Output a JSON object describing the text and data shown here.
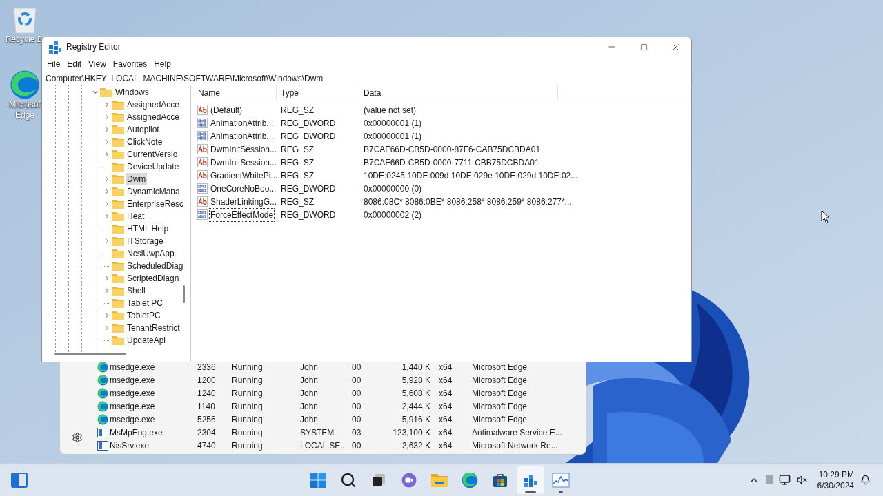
{
  "desktop_icons": [
    {
      "kind": "recycle",
      "lines": [
        "Recycle Bi"
      ]
    },
    {
      "kind": "edge",
      "lines": [
        "Microsof",
        "Edge"
      ]
    }
  ],
  "task_manager": {
    "rows": [
      {
        "kind": "edge",
        "name": "msedge.exe",
        "pid": "2336",
        "status": "Running",
        "user": "John",
        "cpu": "00",
        "memory": "1,440 K",
        "arch": "x64",
        "description": "Microsoft Edge"
      },
      {
        "kind": "edge",
        "name": "msedge.exe",
        "pid": "1200",
        "status": "Running",
        "user": "John",
        "cpu": "00",
        "memory": "5,928 K",
        "arch": "x64",
        "description": "Microsoft Edge"
      },
      {
        "kind": "edge",
        "name": "msedge.exe",
        "pid": "1240",
        "status": "Running",
        "user": "John",
        "cpu": "00",
        "memory": "5,608 K",
        "arch": "x64",
        "description": "Microsoft Edge"
      },
      {
        "kind": "edge",
        "name": "msedge.exe",
        "pid": "1140",
        "status": "Running",
        "user": "John",
        "cpu": "00",
        "memory": "2,444 K",
        "arch": "x64",
        "description": "Microsoft Edge"
      },
      {
        "kind": "edge",
        "name": "msedge.exe",
        "pid": "5256",
        "status": "Running",
        "user": "John",
        "cpu": "00",
        "memory": "5,916 K",
        "arch": "x64",
        "description": "Microsoft Edge"
      },
      {
        "kind": "app",
        "name": "MsMpEng.exe",
        "pid": "2304",
        "status": "Running",
        "user": "SYSTEM",
        "cpu": "03",
        "memory": "123,100 K",
        "arch": "x64",
        "description": "Antimalware Service E..."
      },
      {
        "kind": "app",
        "name": "NisSrv.exe",
        "pid": "4740",
        "status": "Running",
        "user": "LOCAL SE...",
        "cpu": "00",
        "memory": "2,632 K",
        "arch": "x64",
        "description": "Microsoft Network Re..."
      }
    ]
  },
  "registry": {
    "title": "Registry Editor",
    "menu": [
      "File",
      "Edit",
      "View",
      "Favorites",
      "Help"
    ],
    "address": "Computer\\HKEY_LOCAL_MACHINE\\SOFTWARE\\Microsoft\\Windows\\Dwm",
    "tree": {
      "label": "Windows",
      "expanded": true,
      "selected": false,
      "children": [
        {
          "label": "AssignedAcce",
          "expandable": true,
          "selected": false
        },
        {
          "label": "AssignedAcce",
          "expandable": true,
          "selected": false
        },
        {
          "label": "Autopilot",
          "expandable": true,
          "selected": false
        },
        {
          "label": "ClickNote",
          "expandable": true,
          "selected": false
        },
        {
          "label": "CurrentVersio",
          "expandable": true,
          "selected": false
        },
        {
          "label": "DeviceUpdate",
          "expandable": false,
          "selected": false
        },
        {
          "label": "Dwm",
          "expandable": true,
          "selected": true
        },
        {
          "label": "DynamicMana",
          "expandable": true,
          "selected": false
        },
        {
          "label": "EnterpriseResc",
          "expandable": true,
          "selected": false
        },
        {
          "label": "Heat",
          "expandable": true,
          "selected": false
        },
        {
          "label": "HTML Help",
          "expandable": false,
          "selected": false
        },
        {
          "label": "ITStorage",
          "expandable": true,
          "selected": false
        },
        {
          "label": "NcsiUwpApp",
          "expandable": false,
          "selected": false
        },
        {
          "label": "ScheduledDiag",
          "expandable": false,
          "selected": false
        },
        {
          "label": "ScriptedDiagn",
          "expandable": true,
          "selected": false
        },
        {
          "label": "Shell",
          "expandable": true,
          "selected": false
        },
        {
          "label": "Tablet PC",
          "expandable": false,
          "selected": false
        },
        {
          "label": "TabletPC",
          "expandable": true,
          "selected": false
        },
        {
          "label": "TenantRestrict",
          "expandable": true,
          "selected": false
        },
        {
          "label": "UpdateApi",
          "expandable": false,
          "selected": false
        }
      ]
    },
    "columns": [
      "Name",
      "Type",
      "Data"
    ],
    "values": [
      {
        "kind": "string",
        "name": "(Default)",
        "type": "REG_SZ",
        "data": "(value not set)",
        "focused": false
      },
      {
        "kind": "binary",
        "name": "AnimationAttrib...",
        "type": "REG_DWORD",
        "data": "0x00000001 (1)",
        "focused": false
      },
      {
        "kind": "binary",
        "name": "AnimationAttrib...",
        "type": "REG_DWORD",
        "data": "0x00000001 (1)",
        "focused": false
      },
      {
        "kind": "string",
        "name": "DwmInitSession...",
        "type": "REG_SZ",
        "data": "B7CAF66D-CB5D-0000-87F6-CAB75DCBDA01",
        "focused": false
      },
      {
        "kind": "string",
        "name": "DwmInitSession...",
        "type": "REG_SZ",
        "data": "B7CAF66D-CB5D-0000-7711-CBB75DCBDA01",
        "focused": false
      },
      {
        "kind": "string",
        "name": "GradientWhitePi...",
        "type": "REG_SZ",
        "data": "10DE:0245 10DE:009d 10DE:029e 10DE:029d 10DE:02...",
        "focused": false
      },
      {
        "kind": "binary",
        "name": "OneCoreNoBoo...",
        "type": "REG_DWORD",
        "data": "0x00000000 (0)",
        "focused": false
      },
      {
        "kind": "string",
        "name": "ShaderLinkingG...",
        "type": "REG_SZ",
        "data": "8086:08C* 8086:0BE* 8086:258* 8086:259* 8086:277*...",
        "focused": false
      },
      {
        "kind": "binary",
        "name": "ForceEffectMode",
        "type": "REG_DWORD",
        "data": "0x00000002 (2)",
        "focused": true
      }
    ]
  },
  "taskbar": {
    "apps": [
      {
        "kind": "start",
        "active": false,
        "running": false
      },
      {
        "kind": "search",
        "active": false,
        "running": false
      },
      {
        "kind": "taskview",
        "active": false,
        "running": false
      },
      {
        "kind": "chat",
        "active": false,
        "running": false
      },
      {
        "kind": "explorer",
        "active": false,
        "running": false
      },
      {
        "kind": "edge",
        "active": false,
        "running": false
      },
      {
        "kind": "store",
        "active": false,
        "running": false
      },
      {
        "kind": "regedit",
        "active": true,
        "running": true
      },
      {
        "kind": "taskmgr",
        "active": false,
        "running": true
      }
    ],
    "clock": {
      "time": "10:29 PM",
      "date": "6/30/2024"
    }
  }
}
